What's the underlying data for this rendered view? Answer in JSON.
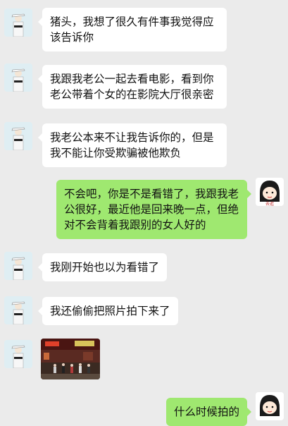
{
  "messages": [
    {
      "side": "in",
      "text": "猪头，我想了很久有件事我觉得应该告诉你"
    },
    {
      "side": "in",
      "text": "我跟我老公一起去看电影，看到你老公带着个女的在影院大厅很亲密"
    },
    {
      "side": "in",
      "text": "我老公本来不让我告诉你的，但是我不能让你受欺骗被他欺负"
    },
    {
      "side": "out",
      "text": "不会吧，你是不是看错了，我跟我老公很好，最近他是回来晚一点，但绝对不会背着我跟别的女人好的"
    },
    {
      "side": "in",
      "text": "我刚开始也以为看错了"
    },
    {
      "side": "in",
      "text": "我还偷偷把照片拍下来了"
    },
    {
      "side": "in",
      "type": "image",
      "icon": "cinema-photo"
    },
    {
      "side": "out",
      "text": "什么时候拍的"
    }
  ],
  "avatars": {
    "contact": "contact-avatar-figure-in-white-hat",
    "self": "self-avatar-cartoon-girl",
    "self_label": "去逛"
  },
  "colors": {
    "background": "#ebebeb",
    "incoming_bubble": "#ffffff",
    "outgoing_bubble": "#9fe870"
  }
}
